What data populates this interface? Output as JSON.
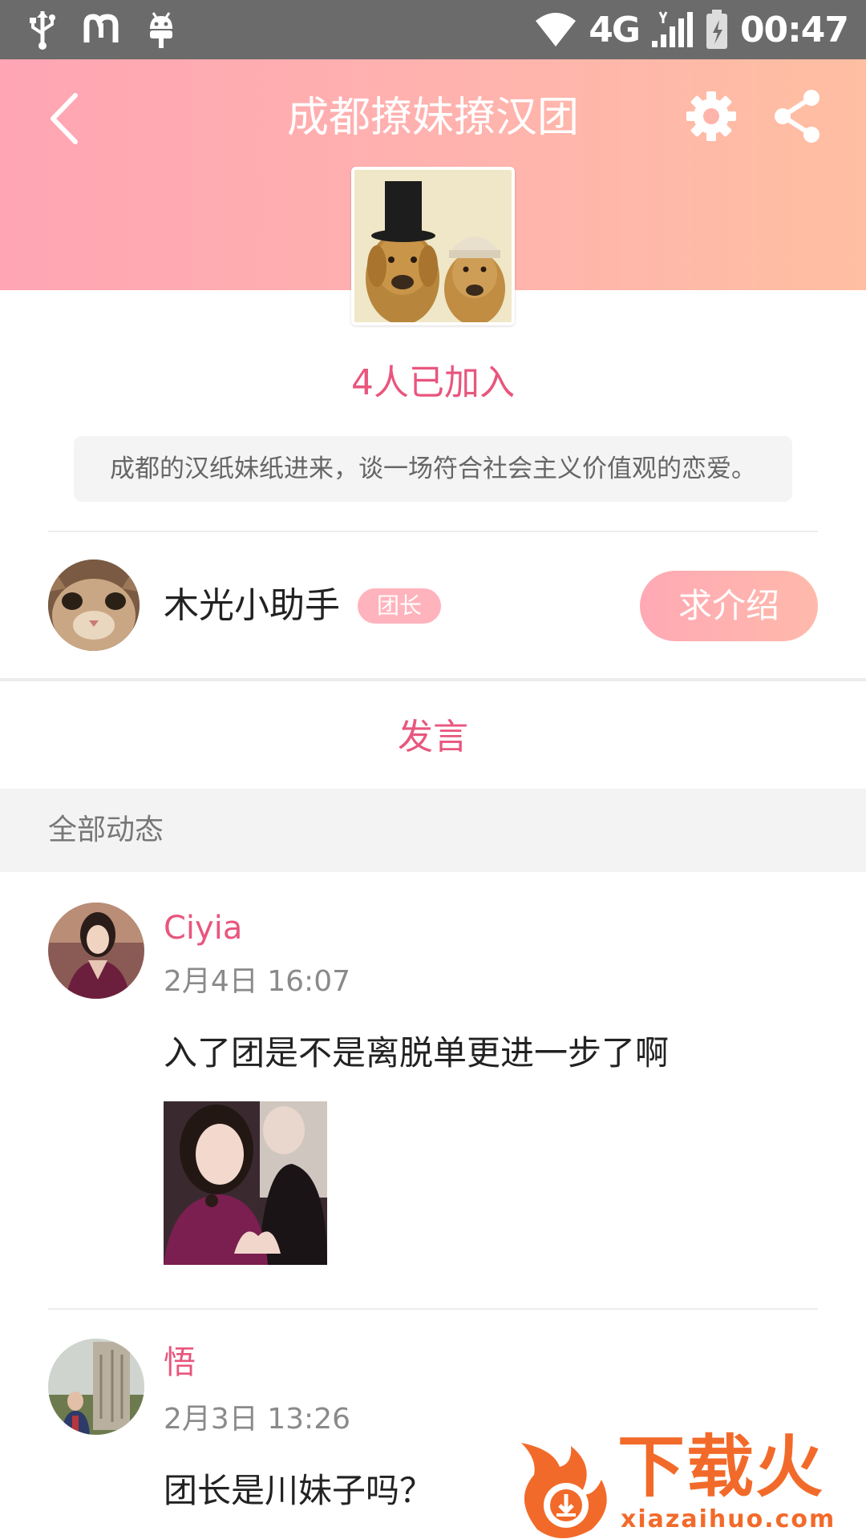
{
  "status_bar": {
    "network": "4G",
    "time": "00:47"
  },
  "header": {
    "title": "成都撩妹撩汉团",
    "icons": [
      "back-arrow-icon",
      "gear-icon",
      "share-icon"
    ]
  },
  "group": {
    "joined": "4人已加入",
    "description": "成都的汉纸妹纸进来，谈一场符合社会主义价值观的恋爱。"
  },
  "leader": {
    "name": "木光小助手",
    "badge": "团长",
    "intro_button": "求介绍"
  },
  "speak_label": "发言",
  "feed": {
    "section_title": "全部动态",
    "posts": [
      {
        "author": "Ciyia",
        "time": "2月4日 16:07",
        "text": "入了团是不是离脱单更进一步了啊"
      },
      {
        "author": "悟",
        "time": "2月3日 13:26",
        "text": "团长是川妹子吗？"
      }
    ]
  },
  "watermark": {
    "cn": "下载火",
    "en": "xiazaihuo.com"
  },
  "colors": {
    "accent": "#e8567d",
    "header_start": "#ffa5b4",
    "header_end": "#ffbfa2",
    "badge": "#ffb3bc",
    "watermark": "#f26a2a"
  }
}
